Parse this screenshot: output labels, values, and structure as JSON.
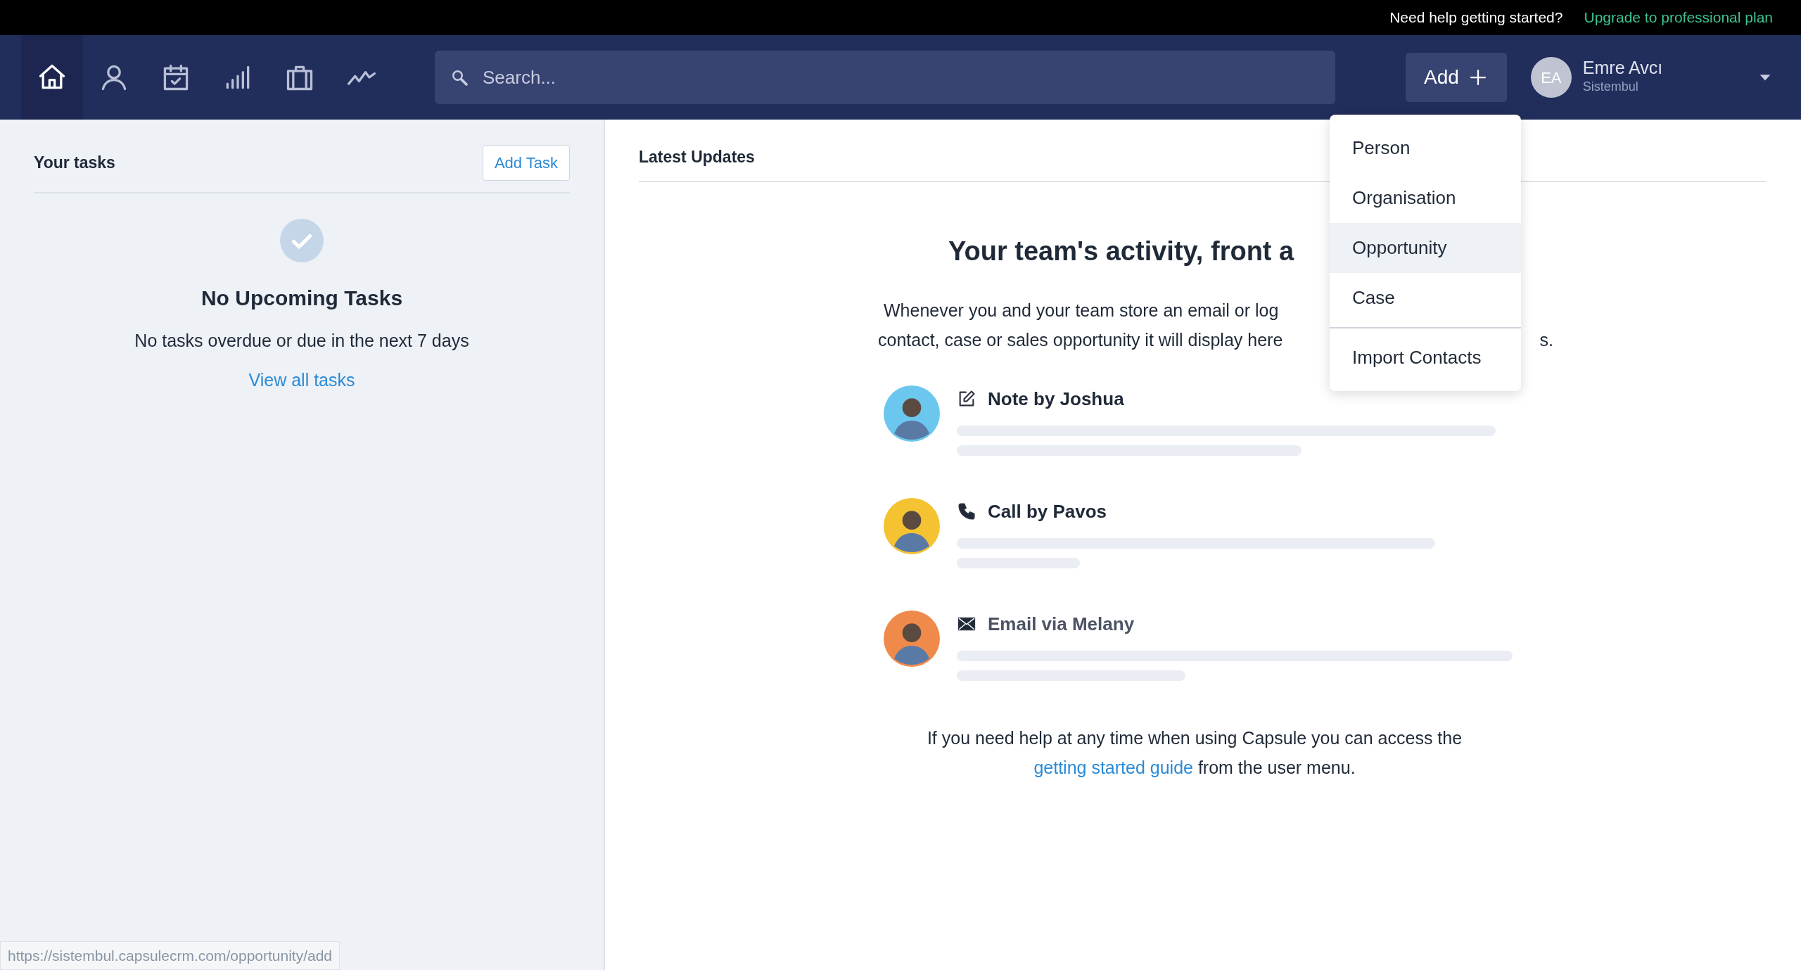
{
  "top_bar": {
    "help_text": "Need help getting started?",
    "upgrade_link": "Upgrade to professional plan"
  },
  "nav": {
    "items": [
      {
        "kind": "home",
        "selected": true
      },
      {
        "kind": "person",
        "selected": false
      },
      {
        "kind": "calendar",
        "selected": false
      },
      {
        "kind": "bars",
        "selected": false
      },
      {
        "kind": "briefcase",
        "selected": false
      },
      {
        "kind": "trend",
        "selected": false
      }
    ],
    "search": {
      "placeholder": "Search..."
    },
    "add_button": "Add",
    "user": {
      "initials": "EA",
      "name": "Emre Avcı",
      "organisation": "Sistembul"
    }
  },
  "tasks": {
    "title": "Your tasks",
    "add_button": "Add Task",
    "empty_title": "No Upcoming Tasks",
    "empty_text": "No tasks overdue or due in the next 7 days",
    "link": "View all tasks"
  },
  "updates": {
    "title": "Latest Updates",
    "heading": "Your team's activity, front a",
    "intro_lines": [
      "Whenever you and your team store an email or log",
      "contact, case or sales opportunity it will display here"
    ],
    "intro_tail": "s.",
    "activities": [
      {
        "kind": "note",
        "title": "Note by Joshua",
        "color": "#6cc7ee",
        "muted": false
      },
      {
        "kind": "call",
        "title": "Call by Pavos",
        "color": "#f5c232",
        "muted": false
      },
      {
        "kind": "email",
        "title": "Email via Melany",
        "color": "#f08a4b",
        "muted": true
      }
    ],
    "help": {
      "before": "If you need help at any time when using Capsule you can access the",
      "link": "getting started guide",
      "after": "from the user menu."
    }
  },
  "add_menu": {
    "items": [
      {
        "label": "Person",
        "selected": false,
        "divider_before": false
      },
      {
        "label": "Organisation",
        "selected": false,
        "divider_before": false
      },
      {
        "label": "Opportunity",
        "selected": true,
        "divider_before": false
      },
      {
        "label": "Case",
        "selected": false,
        "divider_before": false
      },
      {
        "label": "Import Contacts",
        "selected": false,
        "divider_before": true
      }
    ]
  },
  "status_url": "https://sistembul.capsulecrm.com/opportunity/add"
}
